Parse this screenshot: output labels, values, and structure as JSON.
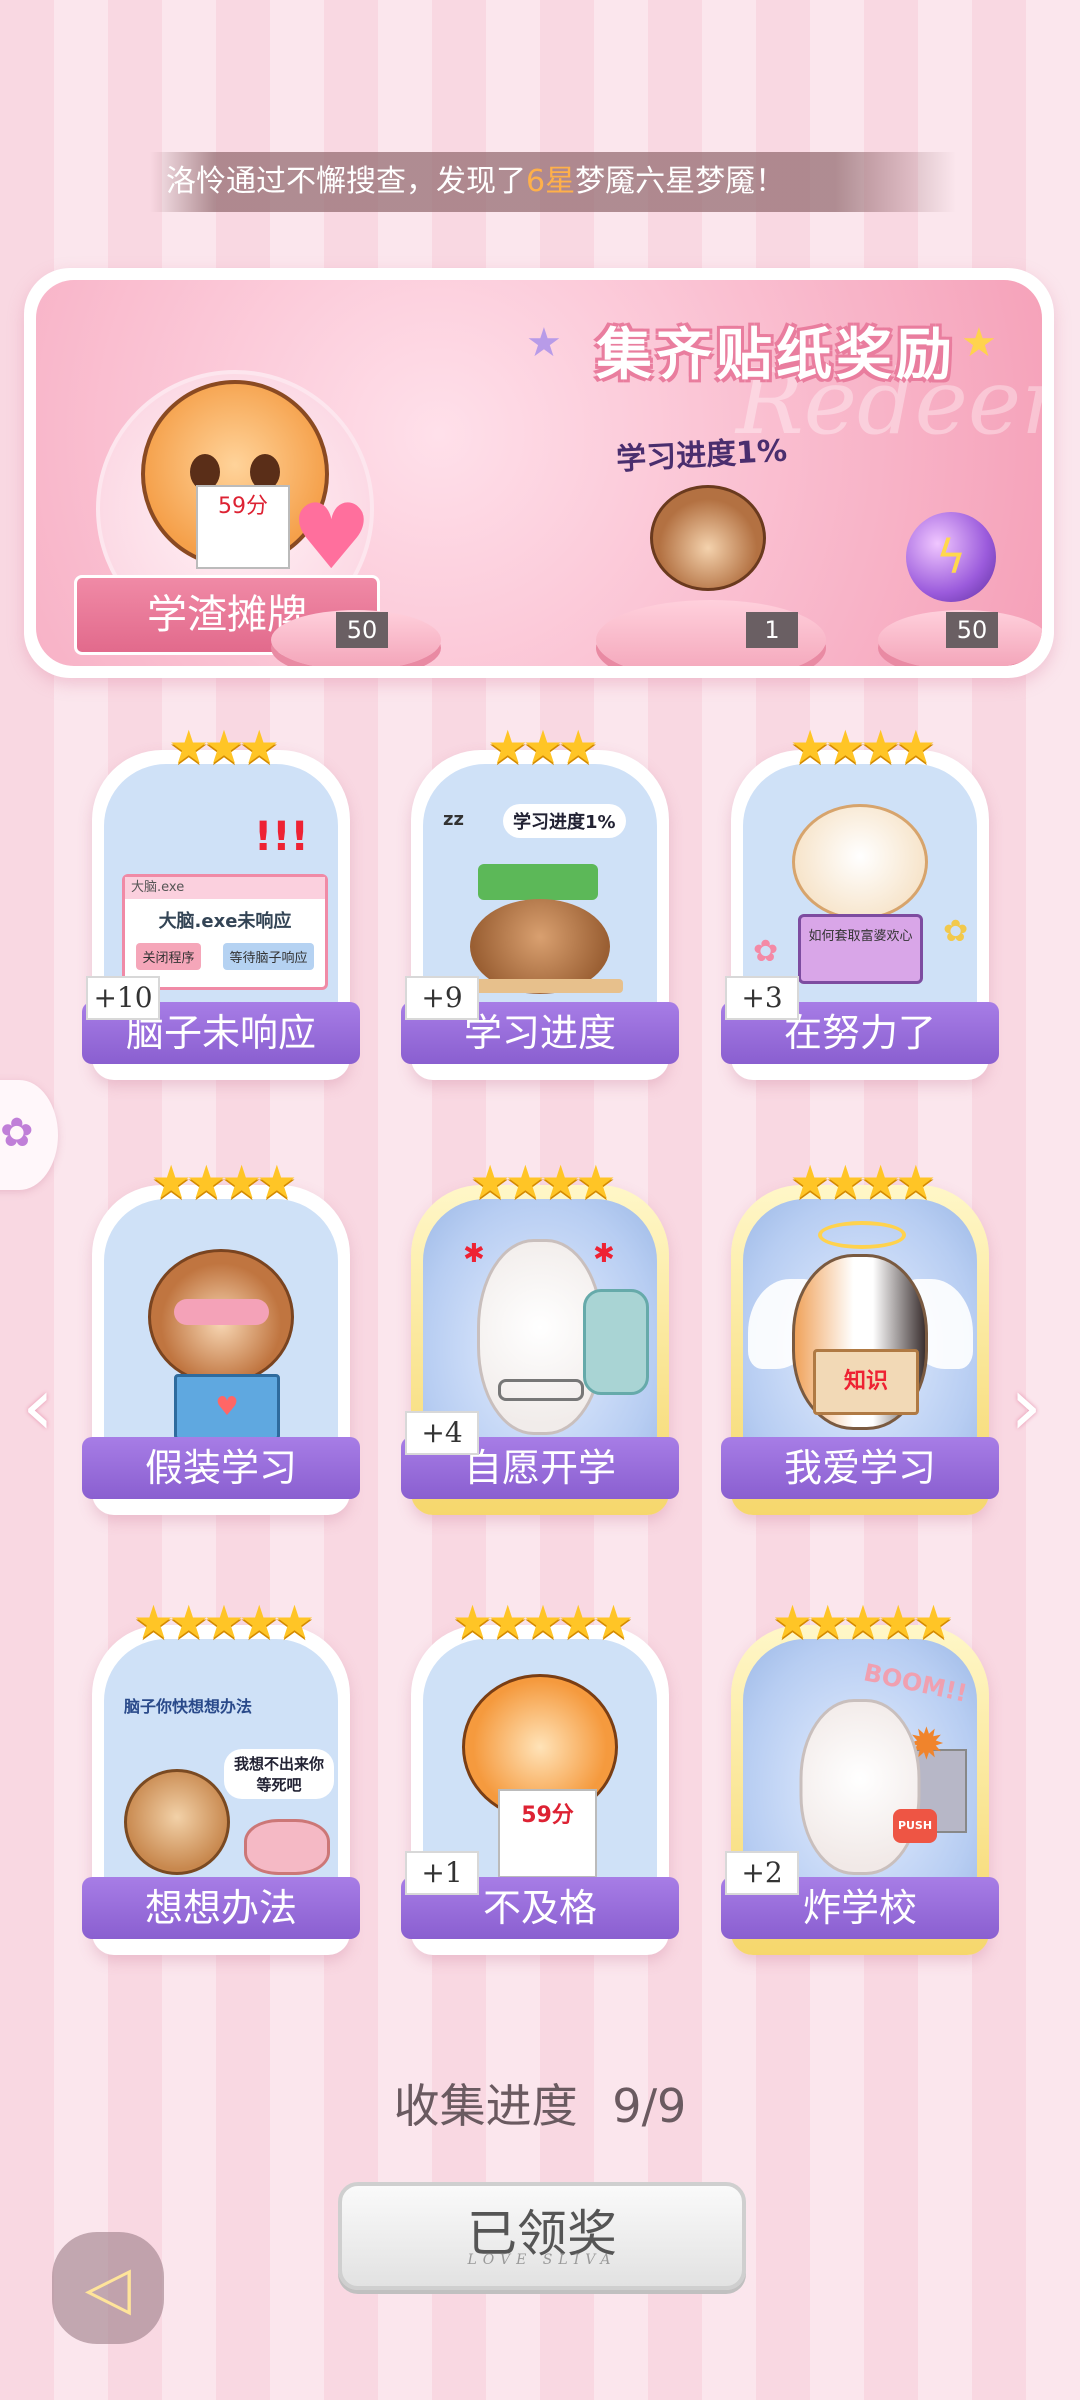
{
  "marquee": {
    "prefix": "洛怜通过不懈搜查，发现了",
    "highlight": "6星",
    "suffix": "梦魇六星梦魇！"
  },
  "reward": {
    "title": "集齐贴纸奖励",
    "watermark": "Redeem",
    "badge_label": "学渣摊牌",
    "badge_paper": "59分",
    "progress_label": "学习进度1%",
    "items": [
      {
        "name": "heart-gem",
        "count": "50"
      },
      {
        "name": "monkey-sticker",
        "count": "1"
      },
      {
        "name": "lightning-orb",
        "count": "50"
      }
    ]
  },
  "cards": [
    {
      "label": "脑子未响应",
      "plus": "+10",
      "stars": "★★★",
      "window_title": "大脑.exe",
      "window_msg": "大脑.exe未响应",
      "btn1": "关闭程序",
      "btn2": "等待脑子响应"
    },
    {
      "label": "学习进度",
      "plus": "+9",
      "stars": "★★★",
      "speech": "学习进度1%",
      "zz": "zz"
    },
    {
      "label": "在努力了",
      "plus": "+3",
      "stars": "★★★★",
      "book": "如何套取富婆欢心"
    },
    {
      "label": "假装学习",
      "plus": "",
      "stars": "★★★★"
    },
    {
      "label": "自愿开学",
      "plus": "+4",
      "stars": "★★★★"
    },
    {
      "label": "我爱学习",
      "plus": "",
      "stars": "★★★★",
      "book": "知识"
    },
    {
      "label": "想想办法",
      "plus": "",
      "stars": "★★★★★",
      "speech1": "脑子你快想想办法",
      "speech2": "我想不出来你等死吧"
    },
    {
      "label": "不及格",
      "plus": "+1",
      "stars": "★★★★★",
      "paper": "59分"
    },
    {
      "label": "炸学校",
      "plus": "+2",
      "stars": "★★★★★",
      "boom": "BOOM!!",
      "push": "PUSH"
    }
  ],
  "collect": {
    "label": "收集进度",
    "value": "9/9"
  },
  "claim": {
    "label": "已领奖",
    "sub": "LOVE SLIVA"
  },
  "icons": {
    "left": "‹",
    "right": "›",
    "back": "◁"
  }
}
